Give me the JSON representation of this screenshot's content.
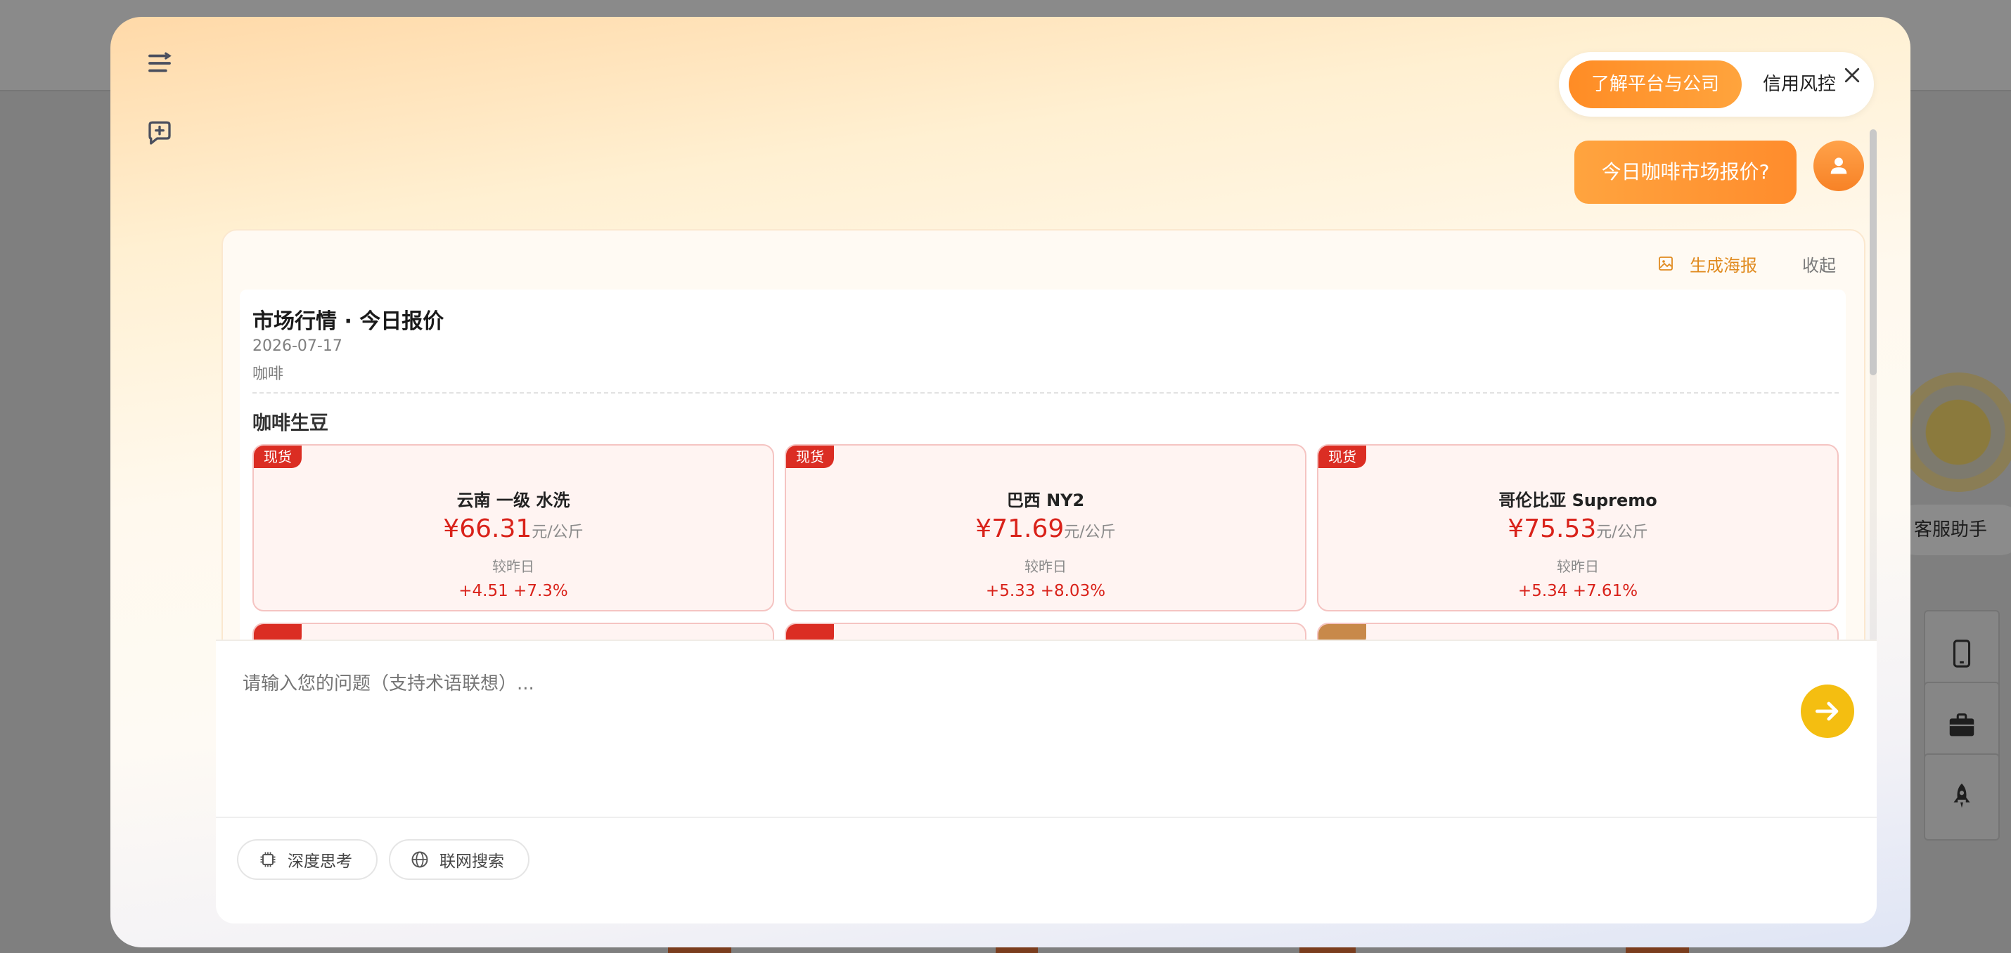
{
  "background": {
    "assistant_label": "客服助手"
  },
  "chat": {
    "quick_chips": [
      "了解平台与公司",
      "信用风控"
    ],
    "user_message": "今日咖啡市场报价?"
  },
  "card": {
    "poster_label": "生成海报",
    "collapse_label": "收起",
    "title": "市场行情 · 今日报价",
    "date": "2026-07-17",
    "category": "咖啡",
    "section": "咖啡生豆",
    "items": [
      {
        "tag": "现货",
        "name": "云南 一级 水洗",
        "price": "¥66.31",
        "unit": "元/公斤",
        "compare_label": "较昨日",
        "change": "+4.51  +7.3%"
      },
      {
        "tag": "现货",
        "name": "巴西 NY2",
        "price": "¥71.69",
        "unit": "元/公斤",
        "compare_label": "较昨日",
        "change": "+5.33  +8.03%"
      },
      {
        "tag": "现货",
        "name": "哥伦比亚 Supremo",
        "price": "¥75.53",
        "unit": "元/公斤",
        "compare_label": "较昨日",
        "change": "+5.34  +7.61%"
      }
    ]
  },
  "input": {
    "placeholder": "请输入您的问题（支持术语联想）...",
    "deep_think_label": "深度思考",
    "web_search_label": "联网搜索"
  },
  "colors": {
    "accent_orange": "#ff8c25",
    "price_red": "#d9221a",
    "send_yellow": "#f4be11",
    "tag_red": "#db2d23"
  },
  "icons": [
    "menu-icon",
    "new-chat-icon",
    "close-icon",
    "user-icon",
    "image-icon",
    "chip-icon",
    "globe-icon",
    "arrow-right-icon",
    "phone-icon",
    "briefcase-icon",
    "rocket-icon"
  ]
}
